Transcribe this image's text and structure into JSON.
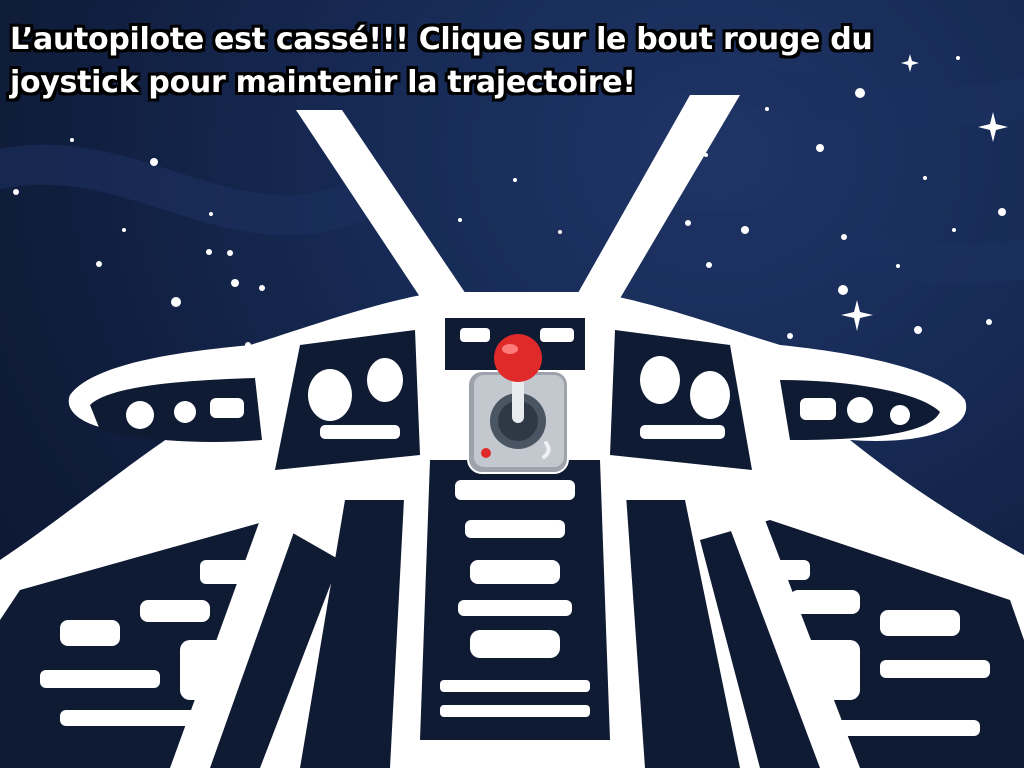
{
  "game": {
    "instruction": "L’autopilote est cassé!!! Clique sur le bout rouge du joystick pour maintenir la trajectoire!"
  },
  "scene": {
    "background": "starfield-cockpit",
    "colors": {
      "space_dark": "#0f1c3a",
      "space_light": "#1f3566",
      "cockpit_line": "#ffffff",
      "joystick_base": "#b8bcc4",
      "joystick_knob": "#e02a2a"
    }
  },
  "joystick": {
    "icon": "joystick-icon",
    "knob_icon": "red-knob-icon"
  }
}
